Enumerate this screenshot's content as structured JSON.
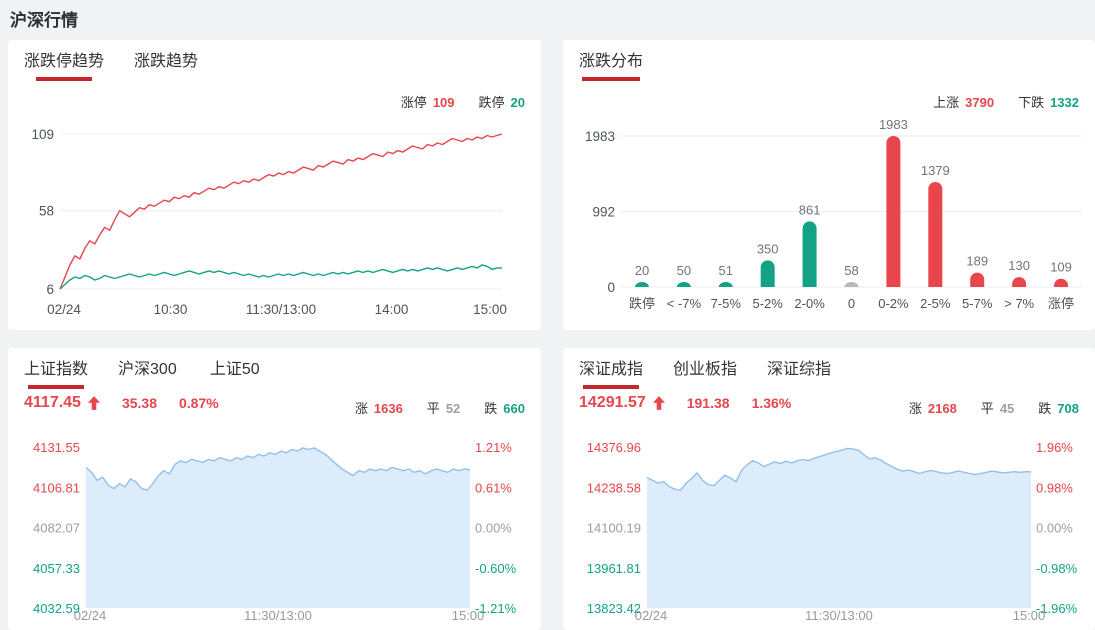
{
  "page": {
    "title": "沪深行情"
  },
  "colors": {
    "red": "#e8454d",
    "green": "#13a384",
    "gray": "#b4b7bc",
    "neutral": "#9aa0a6",
    "axis": "#4d545c",
    "muted": "#6e757d",
    "light_axis": "#999999",
    "grid": "#ebedf0",
    "underline": "#c9252c",
    "blue_line": "#93c0ea",
    "blue_fill": "#ddecfb"
  },
  "panels": {
    "limit_trend": {
      "tabs": [
        {
          "label": "涨跌停趋势"
        },
        {
          "label": "涨跌趋势"
        }
      ],
      "stats": [
        {
          "label": "涨停",
          "value": "109"
        },
        {
          "label": "跌停",
          "value": "20"
        }
      ]
    },
    "distribution": {
      "title": "涨跌分布",
      "stats": [
        {
          "label": "上涨",
          "value": "3790"
        },
        {
          "label": "下跌",
          "value": "1332"
        }
      ]
    },
    "sh_index": {
      "tabs": [
        {
          "label": "上证指数"
        },
        {
          "label": "沪深300"
        },
        {
          "label": "上证50"
        }
      ],
      "quote": {
        "price": "4117.45",
        "change": "35.38",
        "pct": "0.87%"
      },
      "stats": [
        {
          "label": "涨",
          "value": "1636"
        },
        {
          "label": "平",
          "value": "52"
        },
        {
          "label": "跌",
          "value": "660"
        }
      ]
    },
    "sz_index": {
      "tabs": [
        {
          "label": "深证成指"
        },
        {
          "label": "创业板指"
        },
        {
          "label": "深证综指"
        }
      ],
      "quote": {
        "price": "14291.57",
        "change": "191.38",
        "pct": "1.36%"
      },
      "stats": [
        {
          "label": "涨",
          "value": "2168"
        },
        {
          "label": "平",
          "value": "45"
        },
        {
          "label": "跌",
          "value": "708"
        }
      ]
    }
  },
  "chart_data": [
    {
      "type": "line",
      "title": "涨跌停趋势",
      "x_ticks": [
        "02/24",
        "10:30",
        "11:30/13:00",
        "14:00",
        "15:00"
      ],
      "y_ticks": [
        6,
        58,
        109
      ],
      "ylim": [
        6,
        109
      ],
      "grid": true,
      "legend_position": "top-right",
      "series": [
        {
          "name": "涨停",
          "color": "red",
          "values": [
            6,
            14,
            22,
            28,
            26,
            33,
            38,
            36,
            42,
            47,
            45,
            52,
            58,
            56,
            54,
            57,
            60,
            59,
            62,
            61,
            63,
            65,
            64,
            67,
            66,
            68,
            67,
            70,
            69,
            71,
            73,
            72,
            74,
            73,
            75,
            77,
            76,
            78,
            77,
            79,
            78,
            80,
            82,
            81,
            83,
            82,
            84,
            83,
            85,
            87,
            86,
            85,
            88,
            87,
            89,
            91,
            90,
            89,
            92,
            91,
            93,
            92,
            94,
            96,
            95,
            94,
            97,
            96,
            98,
            97,
            99,
            101,
            100,
            99,
            102,
            101,
            103,
            102,
            104,
            106,
            105,
            104,
            106,
            105,
            107,
            106,
            108,
            107,
            108,
            109
          ]
        },
        {
          "name": "跌停",
          "color": "green",
          "values": [
            6,
            9,
            12,
            14,
            13,
            15,
            14,
            12,
            13,
            15,
            14,
            13,
            14,
            15,
            16,
            15,
            14,
            15,
            16,
            15,
            16,
            17,
            16,
            15,
            16,
            17,
            18,
            17,
            16,
            17,
            18,
            17,
            18,
            17,
            16,
            17,
            16,
            15,
            16,
            15,
            14,
            15,
            14,
            15,
            16,
            15,
            16,
            15,
            16,
            17,
            16,
            15,
            16,
            15,
            16,
            17,
            16,
            17,
            16,
            17,
            18,
            17,
            18,
            17,
            18,
            19,
            18,
            17,
            18,
            19,
            18,
            19,
            18,
            19,
            20,
            19,
            20,
            19,
            18,
            19,
            20,
            19,
            20,
            21,
            20,
            22,
            21,
            19,
            20,
            20
          ]
        }
      ]
    },
    {
      "type": "bar",
      "title": "涨跌分布",
      "categories": [
        "跌停",
        "< -7%",
        "7-5%",
        "5-2%",
        "2-0%",
        "0",
        "0-2%",
        "2-5%",
        "5-7%",
        "> 7%",
        "涨停"
      ],
      "values": [
        20,
        50,
        51,
        350,
        861,
        58,
        1983,
        1379,
        189,
        130,
        109
      ],
      "bar_colors": [
        "green",
        "green",
        "green",
        "green",
        "green",
        "gray",
        "red",
        "red",
        "red",
        "red",
        "red"
      ],
      "y_ticks": [
        0,
        992,
        1983
      ],
      "ylim": [
        0,
        1983
      ],
      "grid": true
    },
    {
      "type": "area",
      "title": "上证指数",
      "x_ticks": [
        "02/24",
        "11:30/13:00",
        "15:00"
      ],
      "y_ticks_left": [
        "4131.55",
        "4106.81",
        "4082.07",
        "4057.33",
        "4032.59"
      ],
      "y_ticks_right": [
        "1.21%",
        "0.61%",
        "0.00%",
        "-0.60%",
        "-1.21%"
      ],
      "tick_colors": [
        "red",
        "red",
        "neutral",
        "green",
        "green"
      ],
      "ylim": [
        4032.59,
        4131.55
      ],
      "close": 4117.45,
      "grid": false,
      "values": [
        4119,
        4116,
        4111,
        4113,
        4108,
        4106,
        4109,
        4107,
        4112,
        4110,
        4106,
        4105,
        4109,
        4114,
        4117,
        4115,
        4121,
        4123,
        4122,
        4124,
        4123,
        4122,
        4124,
        4123,
        4125,
        4124,
        4123,
        4125,
        4124,
        4126,
        4125,
        4127,
        4126,
        4128,
        4127,
        4129,
        4128,
        4130,
        4129,
        4131,
        4130,
        4131,
        4129,
        4127,
        4124,
        4121,
        4118,
        4116,
        4114,
        4117,
        4116,
        4118,
        4117,
        4118,
        4117,
        4119,
        4118,
        4117,
        4118,
        4116,
        4117,
        4115,
        4117,
        4118,
        4117,
        4116,
        4118,
        4117,
        4118,
        4117.45
      ]
    },
    {
      "type": "area",
      "title": "深证成指",
      "x_ticks": [
        "02/24",
        "11:30/13:00",
        "15:00"
      ],
      "y_ticks_left": [
        "14376.96",
        "14238.58",
        "14100.19",
        "13961.81",
        "13823.42"
      ],
      "y_ticks_right": [
        "1.96%",
        "0.98%",
        "0.00%",
        "-0.98%",
        "-1.96%"
      ],
      "tick_colors": [
        "red",
        "red",
        "neutral",
        "green",
        "green"
      ],
      "ylim": [
        13823.42,
        14376.96
      ],
      "close": 14291.57,
      "grid": false,
      "values": [
        14272,
        14262,
        14252,
        14258,
        14240,
        14232,
        14228,
        14252,
        14268,
        14288,
        14262,
        14248,
        14244,
        14262,
        14280,
        14270,
        14258,
        14296,
        14316,
        14330,
        14322,
        14310,
        14318,
        14326,
        14320,
        14328,
        14322,
        14330,
        14334,
        14330,
        14338,
        14344,
        14350,
        14356,
        14362,
        14366,
        14372,
        14370,
        14366,
        14350,
        14336,
        14340,
        14332,
        14320,
        14310,
        14300,
        14294,
        14298,
        14292,
        14286,
        14292,
        14296,
        14292,
        14288,
        14286,
        14290,
        14294,
        14290,
        14286,
        14282,
        14286,
        14290,
        14294,
        14291,
        14288,
        14290,
        14292,
        14290,
        14292,
        14291.57
      ]
    }
  ]
}
